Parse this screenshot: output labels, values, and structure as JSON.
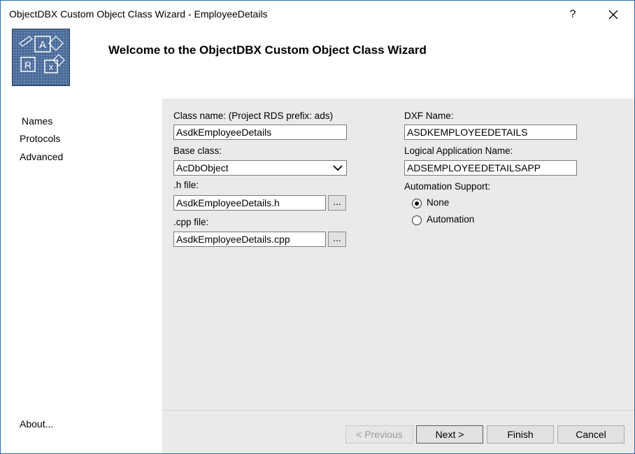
{
  "window": {
    "title": "ObjectDBX Custom Object Class Wizard - EmployeeDetails",
    "help_label": "?",
    "close_label": "✕"
  },
  "header": {
    "title": "Welcome to the ObjectDBX Custom Object Class Wizard",
    "logo_letters": [
      "A",
      "R",
      "x"
    ]
  },
  "nav": {
    "items": [
      {
        "label": "Names",
        "active": true
      },
      {
        "label": "Protocols",
        "active": false
      },
      {
        "label": "Advanced",
        "active": false
      }
    ],
    "about_label": "About..."
  },
  "form": {
    "class_name_label": "Class name: (Project RDS prefix: ads)",
    "class_name_value": "AsdkEmployeeDetails",
    "base_class_label": "Base class:",
    "base_class_value": "AcDbObject",
    "h_file_label": ".h file:",
    "h_file_value": "AsdkEmployeeDetails.h",
    "cpp_file_label": ".cpp file:",
    "cpp_file_value": "AsdkEmployeeDetails.cpp",
    "browse_label": "...",
    "dxf_name_label": "DXF Name:",
    "dxf_name_value": "ASDKEMPLOYEEDETAILS",
    "logical_app_label": "Logical Application Name:",
    "logical_app_value": "ADSEMPLOYEEDETAILSAPP",
    "automation_label": "Automation Support:",
    "automation_options": [
      {
        "label": "None",
        "selected": true
      },
      {
        "label": "Automation",
        "selected": false
      }
    ]
  },
  "buttons": {
    "previous": "< Previous",
    "next": "Next >",
    "finish": "Finish",
    "cancel": "Cancel"
  },
  "colors": {
    "window_border": "#2b6cb0",
    "content_bg": "#eaeaea",
    "logo_bg": "#3b5a86"
  }
}
